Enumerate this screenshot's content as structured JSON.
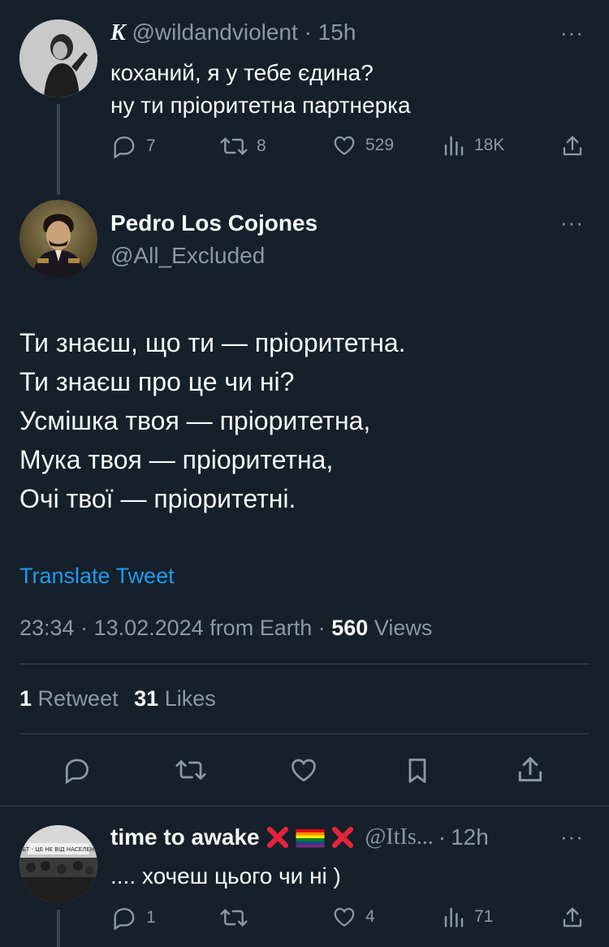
{
  "tweet1": {
    "display_name": "K",
    "handle": "@wildandviolent",
    "sep": "·",
    "time": "15h",
    "lines": [
      "коханий, я у тебе єдина?",
      "ну ти пріоритетна партнерка"
    ],
    "actions": {
      "reply": "7",
      "retweet": "8",
      "like": "529",
      "views": "18K"
    },
    "more": "···"
  },
  "main": {
    "display_name": "Pedro Los Cojones",
    "handle": "@All_Excluded",
    "more": "···",
    "lines": [
      "Ти знаєш, що ти — пріоритетна.",
      "Ти знаєш про це чи ні?",
      "Усмішка твоя — пріоритетна,",
      "Мука твоя — пріоритетна,",
      "Очі твої — пріоритетні."
    ],
    "translate": "Translate Tweet",
    "timestamp": "23:34 · 13.02.2024 from Earth ·",
    "views_count": "560",
    "views_label": "Views",
    "retweets_count": "1",
    "retweets_label": "Retweet",
    "likes_count": "31",
    "likes_label": "Likes"
  },
  "reply": {
    "display_name": "time to awake",
    "handle": "@ItIs...",
    "sep": "·",
    "time": "12h",
    "text": ".... хочеш цього чи ні )",
    "avatar_banner": "ЛГБТ - ЦЕ НЕ ВІД НАСЕЛЕННЯ",
    "actions": {
      "reply": "1",
      "retweet": "",
      "like": "4",
      "views": "71"
    },
    "more": "···"
  },
  "colors": {
    "background": "#15202b",
    "text": "#f7f9f9",
    "muted": "#8b98a5",
    "link": "#1d9bf0",
    "divider": "#38444d",
    "x_mark": "#e5233b"
  },
  "icons": [
    "reply-icon",
    "retweet-icon",
    "like-icon",
    "views-icon",
    "share-icon",
    "bookmark-icon",
    "more-icon",
    "cross-icon",
    "rainbow-flag-icon"
  ]
}
